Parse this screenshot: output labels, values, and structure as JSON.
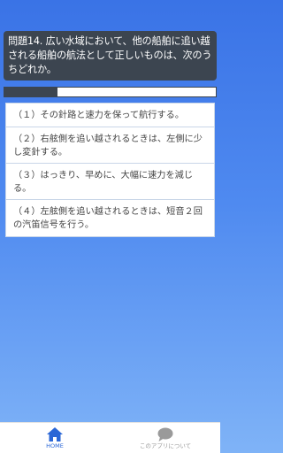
{
  "question": {
    "text": "問題14. 広い水域において、他の船舶に追い越される船舶の航法として正しいものは、次のうちどれか。"
  },
  "progress": {
    "fraction": 0.25
  },
  "answers": [
    {
      "text": "（１）その針路と速力を保って航行する。"
    },
    {
      "text": "（２）右舷側を追い越されるときは、左側に少し変針する。"
    },
    {
      "text": "（３）はっきり、早めに、大幅に速力を減じる。"
    },
    {
      "text": "（４）左舷側を追い越されるときは、短音２回の汽笛信号を行う。"
    }
  ],
  "bottom_nav": {
    "home": {
      "label": "HOME",
      "icon": "home-icon",
      "color": "#2a66d6"
    },
    "about": {
      "label": "このアプリについて",
      "icon": "chat-bubble-icon",
      "color": "#9a9a9a"
    }
  },
  "colors": {
    "question_bg": "#3c4550",
    "background_top": "#3a73e6",
    "background_bottom": "#7fb3f7"
  }
}
